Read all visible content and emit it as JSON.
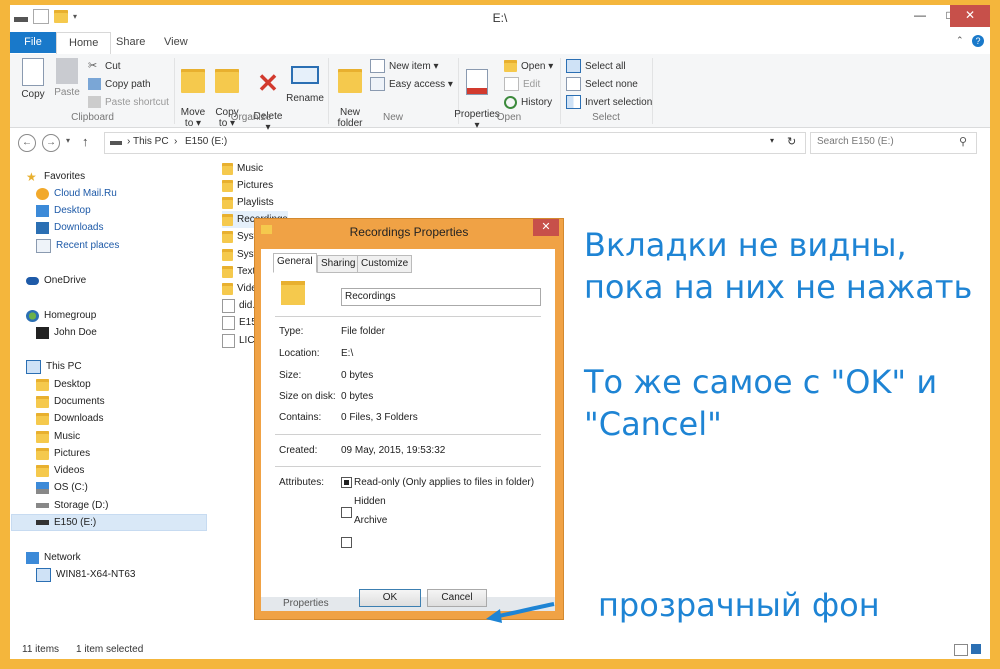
{
  "window": {
    "title": "E:\\"
  },
  "ribbon_tabs": {
    "file": "File",
    "home": "Home",
    "share": "Share",
    "view": "View"
  },
  "clipboard": {
    "copy": "Copy",
    "paste": "Paste",
    "cut": "Cut",
    "copy_path": "Copy path",
    "paste_shortcut": "Paste shortcut",
    "label": "Clipboard"
  },
  "organize": {
    "move_to": "Move\nto ▾",
    "copy_to": "Copy\nto ▾",
    "delete": "Delete\n▾",
    "rename": "Rename",
    "label": "Organize"
  },
  "new_group": {
    "new_folder": "New\nfolder",
    "new_item": "New item ▾",
    "easy_access": "Easy access ▾",
    "label": "New"
  },
  "open_group": {
    "properties": "Properties\n▾",
    "open": "Open ▾",
    "edit": "Edit",
    "history": "History",
    "label": "Open"
  },
  "select_group": {
    "select_all": "Select all",
    "select_none": "Select none",
    "invert_selection": "Invert selection",
    "label": "Select"
  },
  "address": {
    "this_pc": "This PC",
    "drive": "E150 (E:)",
    "search_placeholder": "Search E150 (E:)"
  },
  "nav": {
    "favorites": "Favorites",
    "cloud_mail": "Cloud Mail.Ru",
    "desktop": "Desktop",
    "downloads": "Downloads",
    "recent": "Recent places",
    "onedrive": "OneDrive",
    "homegroup": "Homegroup",
    "john": "John Doe",
    "this_pc": "This PC",
    "pc_desktop": "Desktop",
    "documents": "Documents",
    "pc_downloads": "Downloads",
    "music": "Music",
    "pictures": "Pictures",
    "videos": "Videos",
    "os": "OS (C:)",
    "storage": "Storage (D:)",
    "e150": "E150 (E:)",
    "network": "Network",
    "win81": "WIN81-X64-NT63"
  },
  "files": [
    "Music",
    "Pictures",
    "Playlists",
    "Recordings",
    "Syster",
    "Syster",
    "Text",
    "Video",
    "did.bi",
    "E150.s",
    "LICEN"
  ],
  "status": {
    "count": "11 items",
    "selected": "1 item selected"
  },
  "dialog": {
    "title": "Recordings Properties",
    "tab_general": "General",
    "tab_sharing": "Sharing",
    "tab_customize": "Customize",
    "name": "Recordings",
    "type_label": "Type:",
    "type_val": "File folder",
    "location_label": "Location:",
    "location_val": "E:\\",
    "size_label": "Size:",
    "size_val": "0 bytes",
    "disk_label": "Size on disk:",
    "disk_val": "0 bytes",
    "contains_label": "Contains:",
    "contains_val": "0 Files, 3 Folders",
    "created_label": "Created:",
    "created_val": "09 May, 2015, 19:53:32",
    "attr_label": "Attributes:",
    "readonly": "Read-only (Only applies to files in folder)",
    "hidden": "Hidden",
    "archive": "Archive",
    "ok": "OK",
    "cancel": "Cancel",
    "footer_text": "Properties"
  },
  "annotations": {
    "line1": "Вкладки не видны,",
    "line2": "пока на них не нажать",
    "line3": "То же самое с \"OK\" и",
    "line4": "\"Cancel\"",
    "line5": "прозрачный фон"
  },
  "colors": {
    "accent": "#1979ca",
    "frame": "#f4b63c",
    "annotation": "#1e84d4"
  }
}
